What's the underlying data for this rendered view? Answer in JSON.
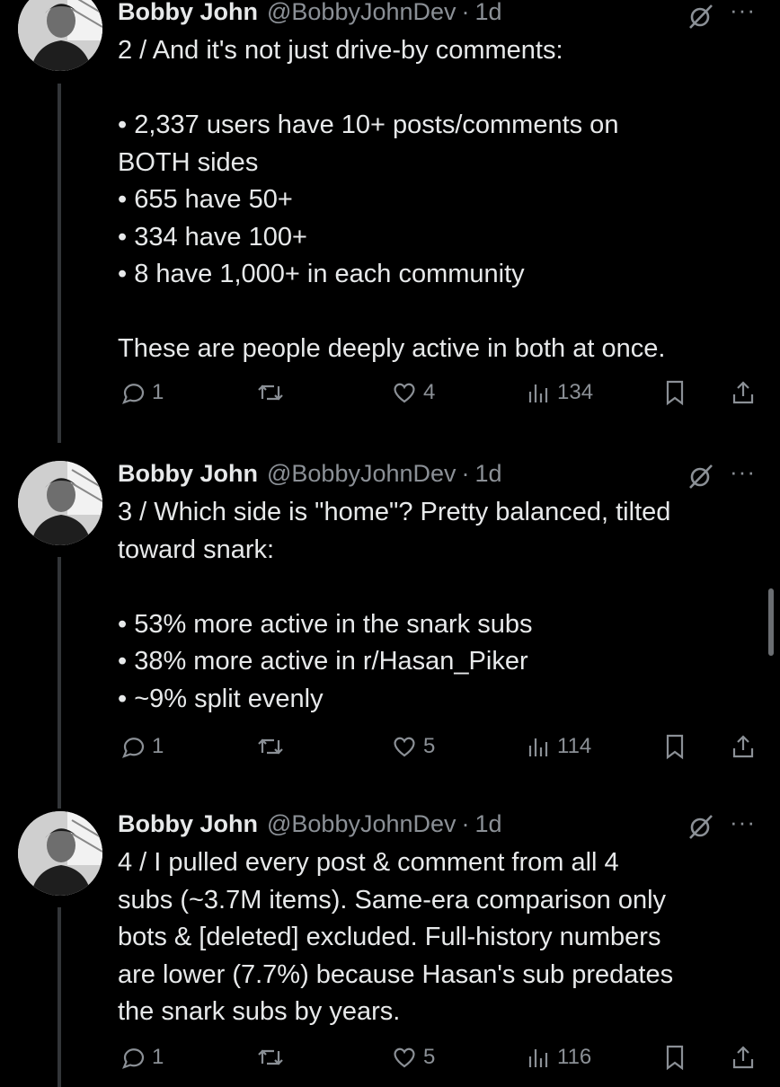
{
  "tweets": [
    {
      "author": "Bobby John",
      "handle": "@BobbyJohnDev",
      "separator": "·",
      "time": "1d",
      "lines": [
        "2 / And it's not just drive-by comments:",
        "",
        "• 2,337 users have 10+ posts/comments on",
        "BOTH sides",
        "• 655 have 50+",
        "• 334 have 100+",
        "• 8 have 1,000+ in each community",
        "",
        "These are people deeply active in both at once."
      ],
      "replies": "1",
      "likes": "4",
      "views": "134"
    },
    {
      "author": "Bobby John",
      "handle": "@BobbyJohnDev",
      "separator": "·",
      "time": "1d",
      "lines": [
        "3 / Which side is \"home\"? Pretty balanced, tilted",
        "toward snark:",
        "",
        "• 53% more active in the snark subs",
        "• 38% more active in r/Hasan_Piker",
        "• ~9% split evenly"
      ],
      "replies": "1",
      "likes": "5",
      "views": "114"
    },
    {
      "author": "Bobby John",
      "handle": "@BobbyJohnDev",
      "separator": "·",
      "time": "1d",
      "lines": [
        "4 / I pulled every post & comment from all 4",
        "subs (~3.7M items). Same-era comparison only",
        "bots & [deleted] excluded. Full-history numbers",
        "are lower (7.7%) because Hasan's sub predates",
        "the snark subs by years."
      ],
      "replies": "1",
      "likes": "5",
      "views": "116"
    }
  ],
  "icons": {
    "reply": "reply-icon",
    "repost": "repost-icon",
    "like": "heart-icon",
    "views": "views-icon",
    "bookmark": "bookmark-icon",
    "share": "share-icon",
    "grok": "grok-icon",
    "more": "more-icon"
  },
  "more_glyph": "···"
}
